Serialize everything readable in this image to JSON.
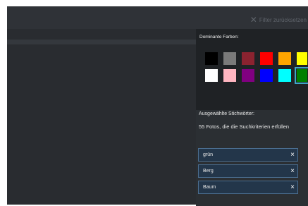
{
  "toolbar": {
    "reset_label": "Filter zurücksetzen",
    "reset_icon": "close-icon"
  },
  "colors": {
    "title": "Dominante Farben:",
    "swatches": [
      {
        "name": "black",
        "hex": "#000000"
      },
      {
        "name": "gray",
        "hex": "#7a7a7a"
      },
      {
        "name": "darkred",
        "hex": "#8b2330"
      },
      {
        "name": "red",
        "hex": "#ff0000"
      },
      {
        "name": "orange",
        "hex": "#ffa500"
      },
      {
        "name": "yellow",
        "hex": "#ffff00"
      },
      {
        "name": "white",
        "hex": "#ffffff"
      },
      {
        "name": "pink",
        "hex": "#ffb6c1"
      },
      {
        "name": "purple",
        "hex": "#800080"
      },
      {
        "name": "blue",
        "hex": "#0000ff"
      },
      {
        "name": "cyan",
        "hex": "#00ffff"
      },
      {
        "name": "green",
        "hex": "#008000",
        "selected": true
      }
    ]
  },
  "keywords": {
    "title": "Ausgewählte Stichwörter:",
    "count_text": "55 Fotos, die die Suchkriterien erfüllen",
    "chips": [
      {
        "label": "grün"
      },
      {
        "label": "Berg"
      },
      {
        "label": "Baum"
      }
    ],
    "remove_glyph": "×"
  },
  "theme": {
    "accent": "#3da6c7",
    "chip_bg": "#23364a",
    "panel_bg": "#1f2225"
  }
}
